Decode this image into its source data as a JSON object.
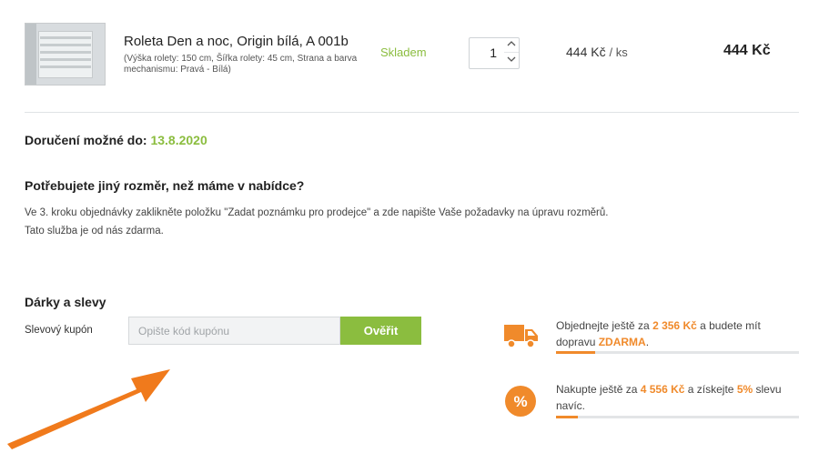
{
  "cart_item": {
    "image_alt": "Roleta Den a noc",
    "name": "Roleta Den a noc, Origin bílá, A 001b",
    "params": "(Výška rolety: 150 cm, Šířka rolety: 45 cm, Strana a barva mechanismu: Pravá - Bílá)",
    "stock_status": "Skladem",
    "quantity": "1",
    "unit_price": "444 Kč",
    "unit_per": "/ ks",
    "total_price": "444 Kč"
  },
  "delivery": {
    "label": "Doručení možné do:",
    "date": "13.8.2020"
  },
  "custom_size": {
    "title": "Potřebujete jiný rozměr, než máme v nabídce?",
    "line1": "Ve 3. kroku objednávky zaklikněte položku \"Zadat poznámku pro prodejce\" a zde napište Vaše požadavky na úpravu rozměrů.",
    "line2": "Tato služba je od nás zdarma."
  },
  "gifts": {
    "title": "Dárky a slevy",
    "coupon_label": "Slevový kupón",
    "coupon_placeholder": "Opište kód kupónu",
    "coupon_value": "",
    "verify_label": "Ověřit"
  },
  "promos": [
    {
      "icon": "truck-icon",
      "text_before": "Objednejte ještě za",
      "amount": "2 356 Kč",
      "text_middle": "a budete mít dopravu",
      "highlight": "ZDARMA",
      "text_after": ".",
      "progress": 0.16
    },
    {
      "icon": "percent-icon",
      "text_before": "Nakupte ještě za",
      "amount": "4 556 Kč",
      "text_middle": "a získejte",
      "highlight": "5%",
      "text_after": "slevu navíc.",
      "progress": 0.09
    }
  ],
  "colors": {
    "accent_green": "#8bbd3f",
    "accent_orange": "#f08a2b"
  }
}
